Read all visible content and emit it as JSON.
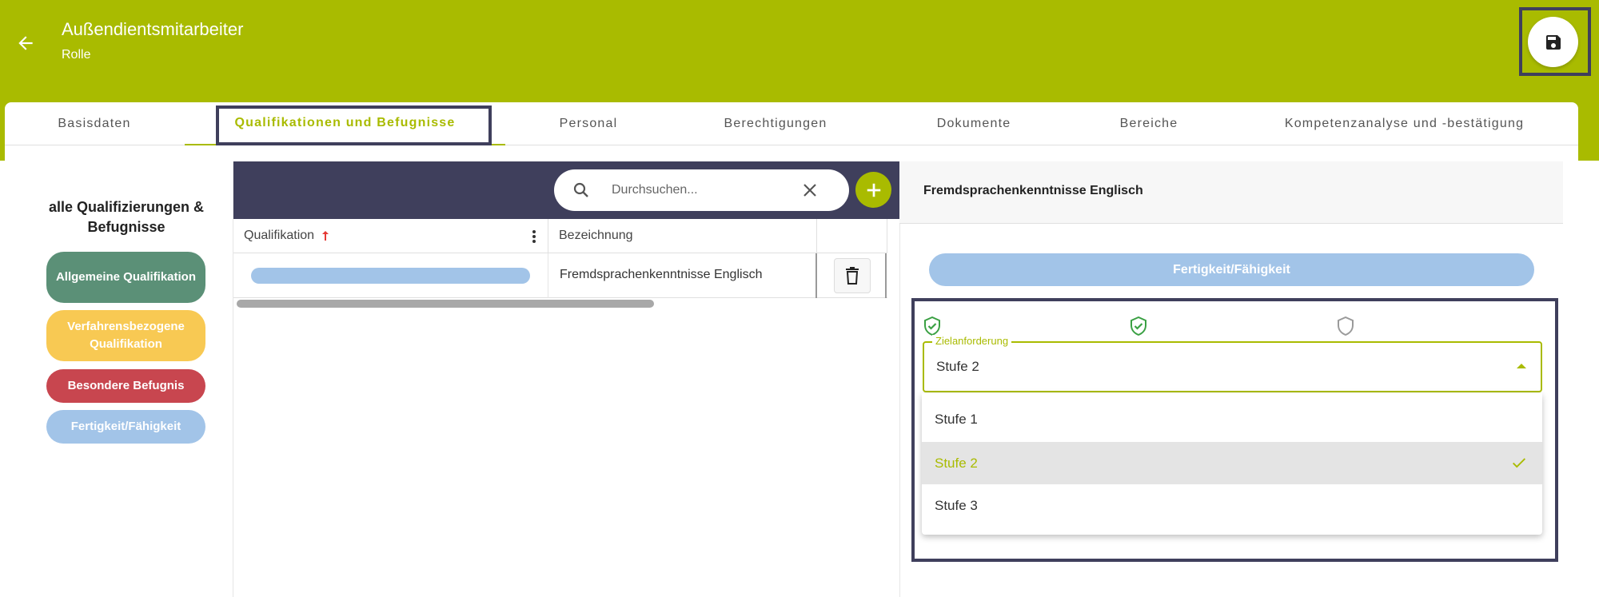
{
  "header": {
    "title": "Außendientsmitarbeiter",
    "subtitle": "Rolle",
    "back_icon": "arrow-left-icon",
    "save_icon": "floppy-disk-icon"
  },
  "tabs": [
    {
      "label": "Basisdaten"
    },
    {
      "label": "Qualifikationen und Befugnisse",
      "active": true
    },
    {
      "label": "Personal"
    },
    {
      "label": "Berechtigungen"
    },
    {
      "label": "Dokumente"
    },
    {
      "label": "Bereiche"
    },
    {
      "label": "Kompetenzanalyse und -bestätigung"
    }
  ],
  "legend": {
    "title": "alle Qualifizierungen & Befugnisse",
    "items": [
      {
        "label": "Allgemeine Qualifikation",
        "color": "#5b9077"
      },
      {
        "label": "Verfahrensbezogene Qualifikation",
        "color": "#f8c953"
      },
      {
        "label": "Besondere Befugnis",
        "color": "#c8464f"
      },
      {
        "label": "Fertigkeit/Fähigkeit",
        "color": "#a2c4e8"
      }
    ]
  },
  "search": {
    "placeholder": "Durchsuchen..."
  },
  "table": {
    "columns": [
      {
        "label": "Qualifikation",
        "sort": "ascending"
      },
      {
        "label": "Bezeichnung"
      }
    ],
    "rows": [
      {
        "bezeichnung": "Fremdsprachenkenntnisse Englisch"
      }
    ]
  },
  "detail": {
    "title": "Fremdsprachenkenntnisse Englisch",
    "category": "Fertigkeit/Fähigkeit",
    "select": {
      "label": "Zielanforderung",
      "value": "Stufe 2",
      "options": [
        "Stufe 1",
        "Stufe 2",
        "Stufe 3"
      ]
    }
  },
  "colors": {
    "brand": "#a9bb00",
    "dark": "#3f3f5c",
    "shield_active": "#3aa043",
    "shield_inactive": "#9a9a9a"
  }
}
